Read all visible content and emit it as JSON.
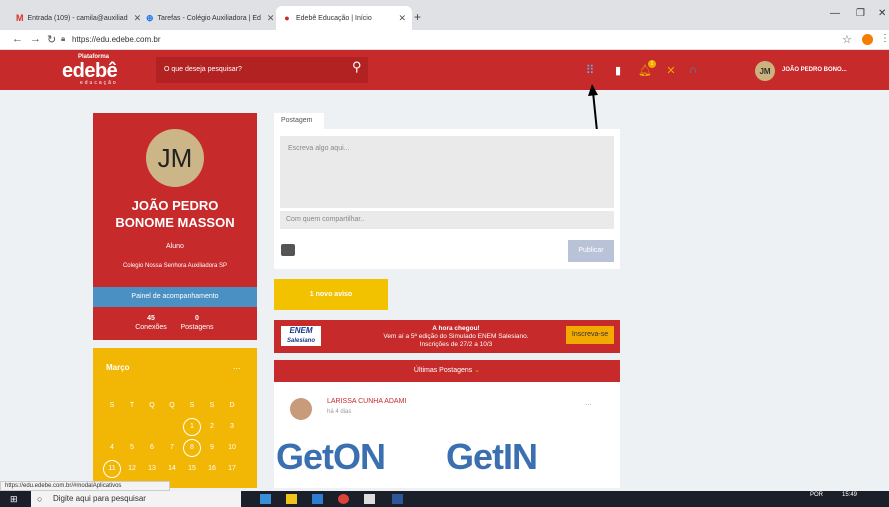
{
  "browser": {
    "tabs": [
      {
        "label": "Entrada (109) - camila@auxiliad",
        "icon": "gmail-icon"
      },
      {
        "label": "Tarefas - Colégio Auxiliadora | Ed",
        "icon": "tasks-icon"
      },
      {
        "label": "Edebê Educação | Início",
        "icon": "edebe-icon"
      }
    ],
    "url": "https://edu.edebe.com.br",
    "status_url": "https://edu.edebe.com.br/#modalAplicativos"
  },
  "header": {
    "logo_top": "Plataforma",
    "logo_main": "edebê",
    "logo_sub": "educação",
    "search_placeholder": "O que deseja pesquisar?",
    "notification_count": "1",
    "user_initials": "JM",
    "user_name": "JOÃO PEDRO BONO..."
  },
  "profile": {
    "initials": "JM",
    "name_line1": "JOÃO PEDRO",
    "name_line2": "BONOME MASSON",
    "role": "Aluno",
    "school": "Colegio Nossa Senhora Auxiliadora SP",
    "panel_button": "Painel de acompanhamento",
    "connections_value": "45",
    "connections_label": "Conexões",
    "posts_value": "0",
    "posts_label": "Postagens"
  },
  "calendar": {
    "month": "Março",
    "more": "...",
    "weekdays": [
      "S",
      "T",
      "Q",
      "Q",
      "S",
      "S",
      "D"
    ],
    "row1": [
      "1",
      "2",
      "3"
    ],
    "row2": [
      "4",
      "5",
      "6",
      "7",
      "8",
      "9",
      "10"
    ],
    "row3": [
      "11",
      "12",
      "13",
      "14",
      "15",
      "16",
      "17"
    ]
  },
  "post": {
    "tab_label": "Postagem",
    "placeholder": "Escreva algo aqui...",
    "share_placeholder": "Com quem compartilhar..",
    "publish": "Publicar"
  },
  "aviso": "1 novo aviso",
  "enem": {
    "logo_top": "ENEM",
    "logo_bottom": "Salesiano",
    "line1": "A hora chegou!",
    "line2": "Vem aí a 5ª edição do Simulado ENEM Salesiano.",
    "line3": "Inscrições de 27/2 a 10/3",
    "button": "Inscreva-se"
  },
  "feed": {
    "header": "Últimas Postagens",
    "author": "LARISSA CUNHA ADAMI",
    "time": "há 4 dias",
    "more": "...",
    "banner_left": "GetON",
    "banner_right": "GetIN"
  },
  "taskbar": {
    "search": "Digite aqui para pesquisar",
    "lang": "POR",
    "time": "15:49"
  }
}
